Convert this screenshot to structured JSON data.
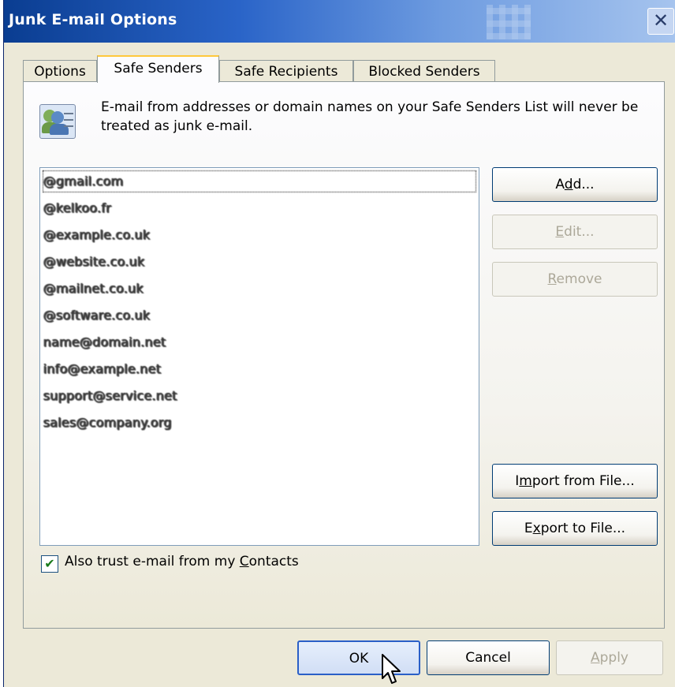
{
  "window": {
    "title": "Junk E-mail Options",
    "close_glyph": "✕"
  },
  "tabs": [
    {
      "label": "Options",
      "active": false
    },
    {
      "label": "Safe Senders",
      "active": true
    },
    {
      "label": "Safe Recipients",
      "active": false
    },
    {
      "label": "Blocked Senders",
      "active": false
    }
  ],
  "info": {
    "icon": "people-list-icon",
    "text": "E-mail from addresses or domain names on your Safe Senders List will never be treated as junk e-mail."
  },
  "safe_senders_list": {
    "items": [
      "@gmail.com",
      "@kelkoo.fr",
      "@example.co.uk",
      "@website.co.uk",
      "@mailnet.co.uk",
      "@software.co.uk",
      "name@domain.net",
      "info@example.net",
      "support@service.net",
      "sales@company.org"
    ],
    "focused_index": 0,
    "redacted": true
  },
  "buttons": {
    "add": {
      "pre": "A",
      "u": "d",
      "post": "d...",
      "enabled": true
    },
    "edit": {
      "pre": "",
      "u": "E",
      "post": "dit...",
      "enabled": false
    },
    "remove": {
      "pre": "",
      "u": "R",
      "post": "emove",
      "enabled": false
    },
    "import": {
      "pre": "I",
      "u": "m",
      "post": "port from File...",
      "enabled": true
    },
    "export": {
      "pre": "E",
      "u": "x",
      "post": "port to File...",
      "enabled": true
    }
  },
  "trust_contacts": {
    "checked": true,
    "check_glyph": "✔",
    "label_pre": "Also trust e-mail from my ",
    "label_u": "C",
    "label_post": "ontacts"
  },
  "footer": {
    "ok_label": "OK",
    "cancel_label": "Cancel",
    "apply_pre": "",
    "apply_u": "A",
    "apply_post": "pply",
    "apply_enabled": false
  },
  "cursor": {
    "icon": "mouse-pointer-icon"
  }
}
